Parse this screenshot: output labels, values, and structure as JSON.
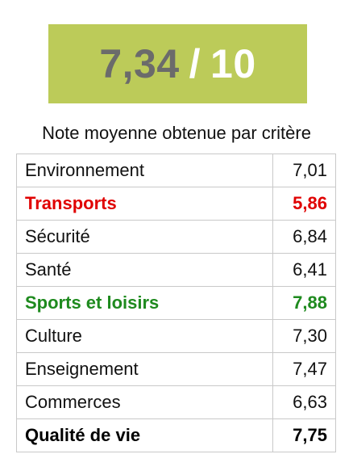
{
  "score": {
    "value": "7,34",
    "separator": "/",
    "max": "10",
    "background_color": "#bccb59",
    "value_color": "#6b6b6b"
  },
  "caption": "Note moyenne obtenue par critère",
  "criteria": [
    {
      "label": "Environnement",
      "value": "7,01",
      "style": "normal"
    },
    {
      "label": "Transports",
      "value": "5,86",
      "style": "red"
    },
    {
      "label": "Sécurité",
      "value": "6,84",
      "style": "normal"
    },
    {
      "label": "Santé",
      "value": "6,41",
      "style": "normal"
    },
    {
      "label": "Sports et loisirs",
      "value": "7,88",
      "style": "green"
    },
    {
      "label": "Culture",
      "value": "7,30",
      "style": "normal"
    },
    {
      "label": "Enseignement",
      "value": "7,47",
      "style": "normal"
    },
    {
      "label": "Commerces",
      "value": "6,63",
      "style": "normal"
    },
    {
      "label": "Qualité de vie",
      "value": "7,75",
      "style": "bold"
    }
  ],
  "colors": {
    "worst": "#e00000",
    "best": "#1e8a1e"
  }
}
